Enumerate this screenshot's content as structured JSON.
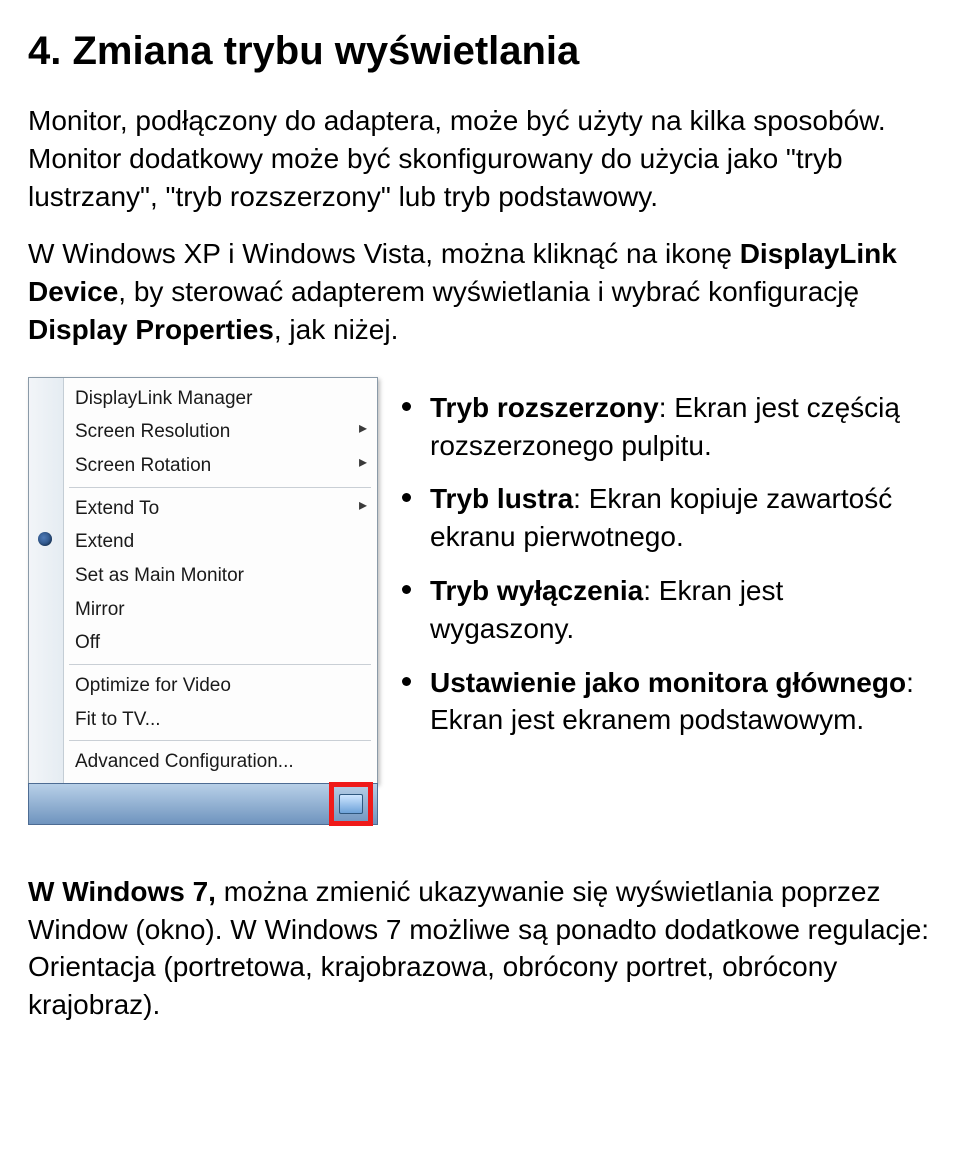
{
  "heading": "4. Zmiana trybu wyświetlania",
  "para1": "Monitor, podłączony do adaptera, może być użyty na kilka sposobów. Monitor dodatkowy może być skonfigurowany do użycia jako \"tryb lustrzany\", \"tryb rozszerzony\" lub tryb podstawowy.",
  "para2_pre": "W Windows XP i Windows Vista, można kliknąć na ikonę ",
  "para2_bold1": "DisplayLink Device",
  "para2_mid": ", by sterować adapterem wyświetlania i wybrać konfigurację ",
  "para2_bold2": "Display Properties",
  "para2_post": ", jak niżej.",
  "menu": {
    "items": [
      {
        "label": "DisplayLink Manager",
        "sub": false
      },
      {
        "label": "Screen Resolution",
        "sub": true
      },
      {
        "label": "Screen Rotation",
        "sub": true
      },
      {
        "sep": true
      },
      {
        "label": "Extend To",
        "sub": true
      },
      {
        "label": "Extend",
        "sub": false,
        "radio": true
      },
      {
        "label": "Set as Main Monitor",
        "sub": false
      },
      {
        "label": "Mirror",
        "sub": false
      },
      {
        "label": "Off",
        "sub": false
      },
      {
        "sep": true
      },
      {
        "label": "Optimize for Video",
        "sub": false
      },
      {
        "label": "Fit to TV...",
        "sub": false
      },
      {
        "sep": true
      },
      {
        "label": "Advanced Configuration...",
        "sub": false
      }
    ]
  },
  "modes": [
    {
      "title": "Tryb rozszerzony",
      "desc": ": Ekran jest częścią rozszerzonego pulpitu."
    },
    {
      "title": "Tryb lustra",
      "desc": ": Ekran kopiuje zawartość ekranu pierwotnego."
    },
    {
      "title": "Tryb wyłączenia",
      "desc": ": Ekran jest wygaszony."
    },
    {
      "title": "Ustawienie jako monitora głównego",
      "desc": ": Ekran jest ekranem podstawowym."
    }
  ],
  "bottom_lead": "W Windows 7, ",
  "bottom_rest": "można zmienić ukazywanie się wyświetlania poprzez Window (okno). W Windows 7 możliwe są ponadto dodatkowe regulacje: Orientacja (portretowa, krajobrazowa, obrócony portret, obrócony krajobraz)."
}
